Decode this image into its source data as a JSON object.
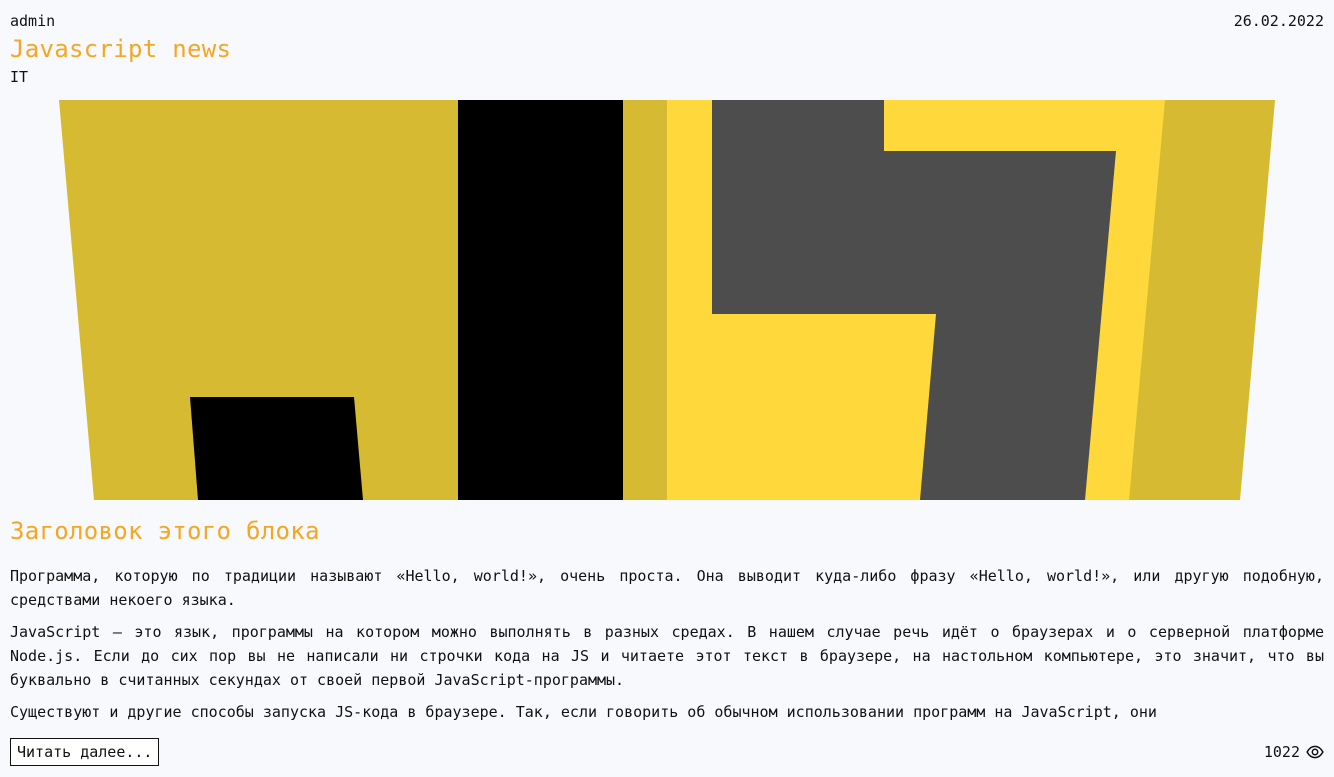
{
  "post": {
    "author": "admin",
    "date": "26.02.2022",
    "title": "Javascript news",
    "category": "IT",
    "image": {
      "icon": "javascript-logo",
      "colors": {
        "mustard": "#d6bb32",
        "yellow": "#ffd83b",
        "black": "#000000",
        "gray": "#4d4d4d"
      }
    },
    "block_title": "Заголовок этого блока",
    "paragraphs": [
      "Программа, которую по традиции называют «Hello, world!», очень проста. Она выводит куда-либо фразу «Hello, world!», или другую подобную, средствами некоего языка.",
      "JavaScript — это язык, программы на котором можно выполнять в разных средах. В нашем случае речь идёт о браузерах и о серверной платформе Node.js. Если до сих пор вы не написали ни строчки кода на JS и читаете этот текст в браузере, на настольном компьютере, это значит, что вы буквально в считанных секундах от своей первой JavaScript-программы.",
      "Существуют и другие способы запуска JS-кода в браузере. Так, если говорить об обычном использовании программ на JavaScript, они"
    ],
    "read_more_label": "Читать далее...",
    "views": "1022",
    "views_icon": "eye-icon",
    "accent_color": "#f5a623"
  }
}
